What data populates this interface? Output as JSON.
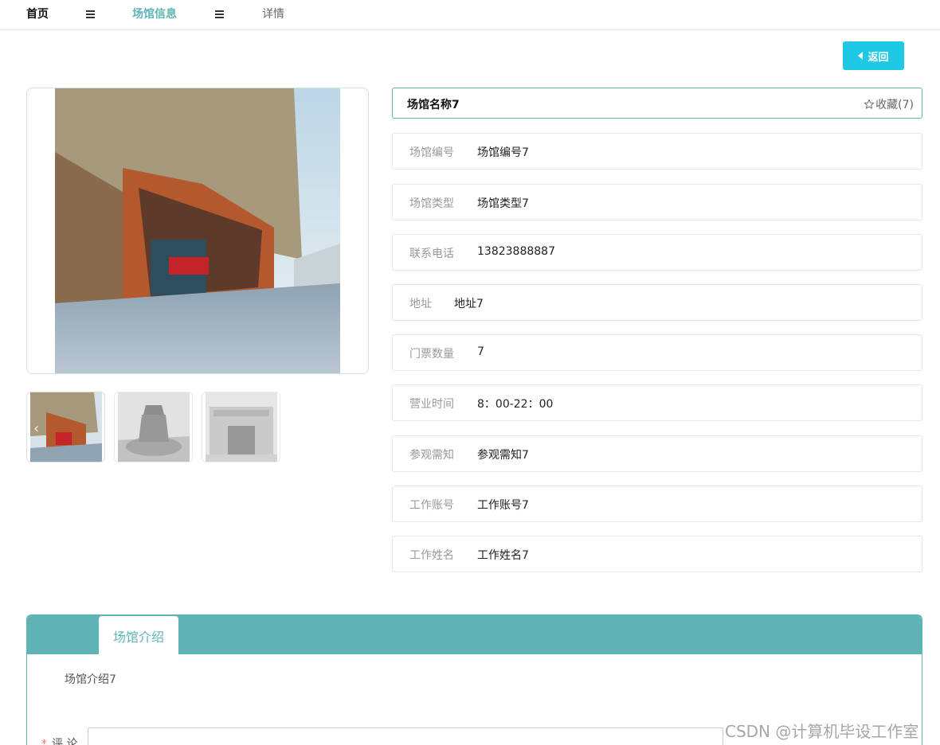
{
  "breadcrumb": {
    "home": "首页",
    "current": "场馆信息",
    "detail": "详情"
  },
  "back_button": {
    "label": "返回"
  },
  "venue": {
    "name": "场馆名称7",
    "favorite_label": "收藏(7)"
  },
  "fields": [
    {
      "label": "场馆编号",
      "value": "场馆编号7"
    },
    {
      "label": "场馆类型",
      "value": "场馆类型7"
    },
    {
      "label": "联系电话",
      "value": "13823888887"
    },
    {
      "label": "地址",
      "value": "地址7"
    },
    {
      "label": "门票数量",
      "value": "7"
    },
    {
      "label": "营业时间",
      "value": "8：00-22：00"
    },
    {
      "label": "参观需知",
      "value": "参观需知7"
    },
    {
      "label": "工作账号",
      "value": "工作账号7"
    },
    {
      "label": "工作姓名",
      "value": "工作姓名7"
    }
  ],
  "intro": {
    "tab": "场馆介绍",
    "content": "场馆介绍7"
  },
  "comment": {
    "required_mark": "*",
    "label": "评 论"
  },
  "watermark": "CSDN @计算机毕设工作室",
  "colors": {
    "accent": "#5fb3b5",
    "back_button": "#1ec9e6",
    "required": "#f56c6c"
  },
  "icons": [
    "menu-icon",
    "star-outline-icon",
    "caret-left-icon",
    "chevron-left-icon"
  ]
}
